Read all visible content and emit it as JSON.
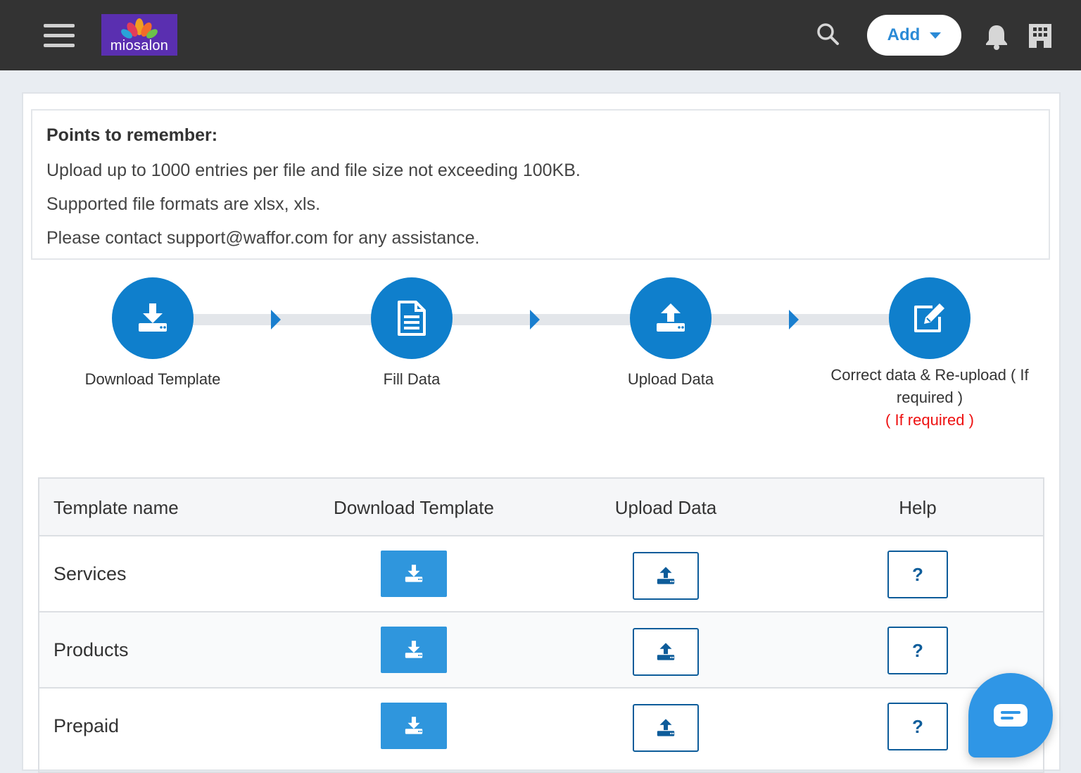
{
  "header": {
    "logo_text": "miosalon",
    "add_label": "Add",
    "icons": [
      "menu-icon",
      "search-icon",
      "bell-icon",
      "building-icon"
    ]
  },
  "notes": {
    "title": "Points to remember:",
    "lines": [
      "Upload up to 1000 entries per file and file size not exceeding 100KB.",
      "Supported file formats are xlsx, xls.",
      "Please contact support@waffor.com for any assistance."
    ]
  },
  "steps": [
    {
      "label": "Download Template",
      "icon": "download-icon"
    },
    {
      "label": "Fill Data",
      "icon": "document-icon"
    },
    {
      "label": "Upload Data",
      "icon": "upload-icon"
    },
    {
      "label": "Correct data & Re-upload ( If required )",
      "sub": "( If required )",
      "icon": "edit-icon"
    }
  ],
  "table": {
    "headers": [
      "Template name",
      "Download Template",
      "Upload Data",
      "Help"
    ],
    "rows": [
      {
        "name": "Services",
        "help": "?"
      },
      {
        "name": "Products",
        "help": "?"
      },
      {
        "name": "Prepaid",
        "help": "?"
      }
    ]
  },
  "colors": {
    "topbar": "#333333",
    "primary": "#0f7fcc",
    "download_button": "#2f96dd",
    "outline": "#0d5c9a",
    "warning": "#ee1111"
  }
}
